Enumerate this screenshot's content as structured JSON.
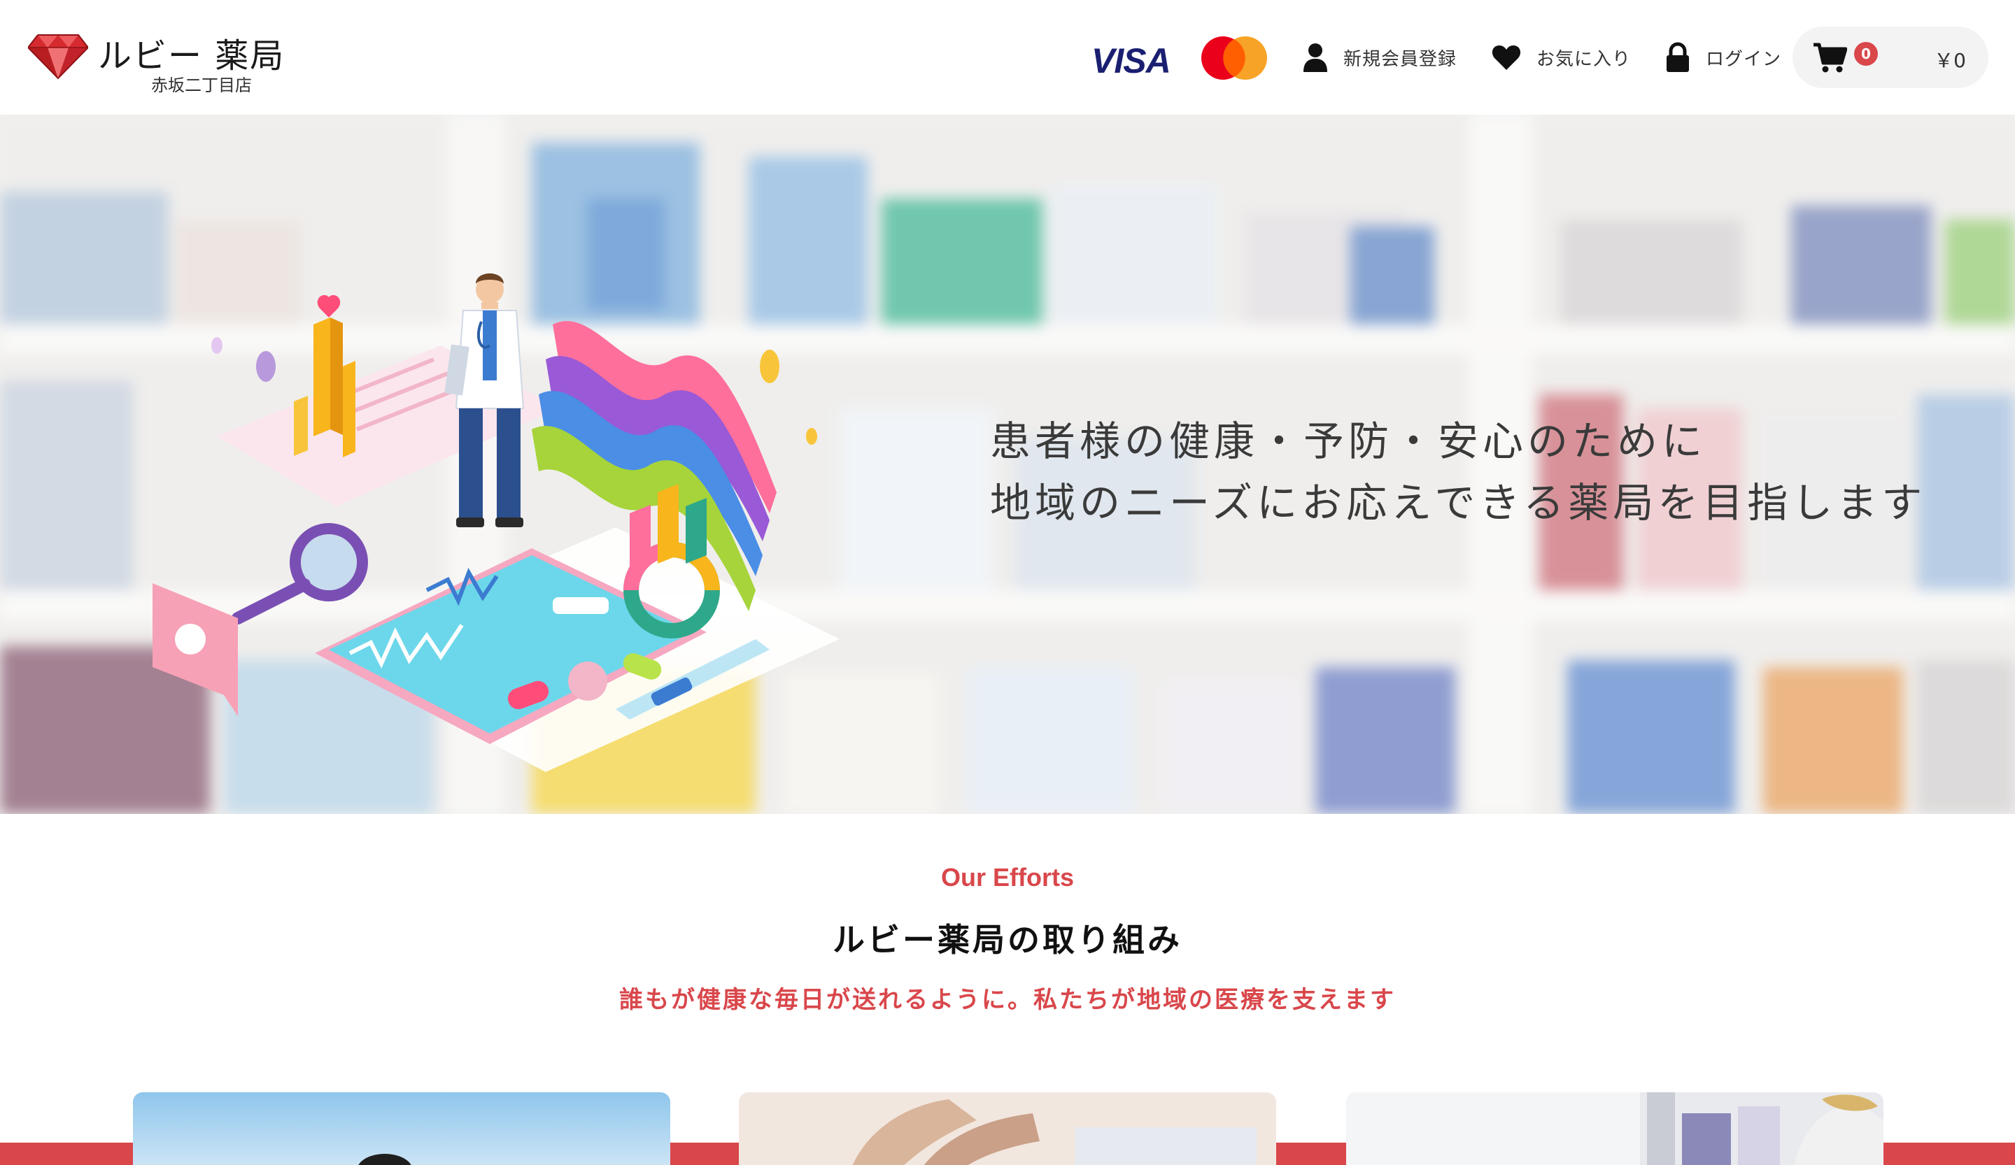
{
  "header": {
    "brand_name": "ルビー 薬局",
    "branch_name": "赤坂二丁目店",
    "payment_visa_label": "VISA",
    "nav": {
      "register_label": "新規会員登録",
      "favorites_label": "お気に入り",
      "login_label": "ログイン"
    },
    "cart": {
      "count": "0",
      "total": "￥0"
    }
  },
  "hero": {
    "line1": "患者様の健康・予防・安心のために",
    "line2": "地域のニーズにお応えできる薬局を目指します"
  },
  "efforts": {
    "eyebrow": "Our Efforts",
    "title": "ルビー薬局の取り組み",
    "subtitle": "誰もが健康な毎日が送れるように。私たちが地域の医療を支えます"
  },
  "icons": {
    "logo": "ruby-gem-icon",
    "register": "user-icon",
    "favorites": "heart-icon",
    "login": "lock-icon",
    "cart": "cart-icon"
  },
  "colors": {
    "accent": "#d9474b",
    "visa": "#1a1f71",
    "mastercard_red": "#eb001b",
    "mastercard_orange": "#f79e1b",
    "cart_pill": "#f3f3f3"
  }
}
